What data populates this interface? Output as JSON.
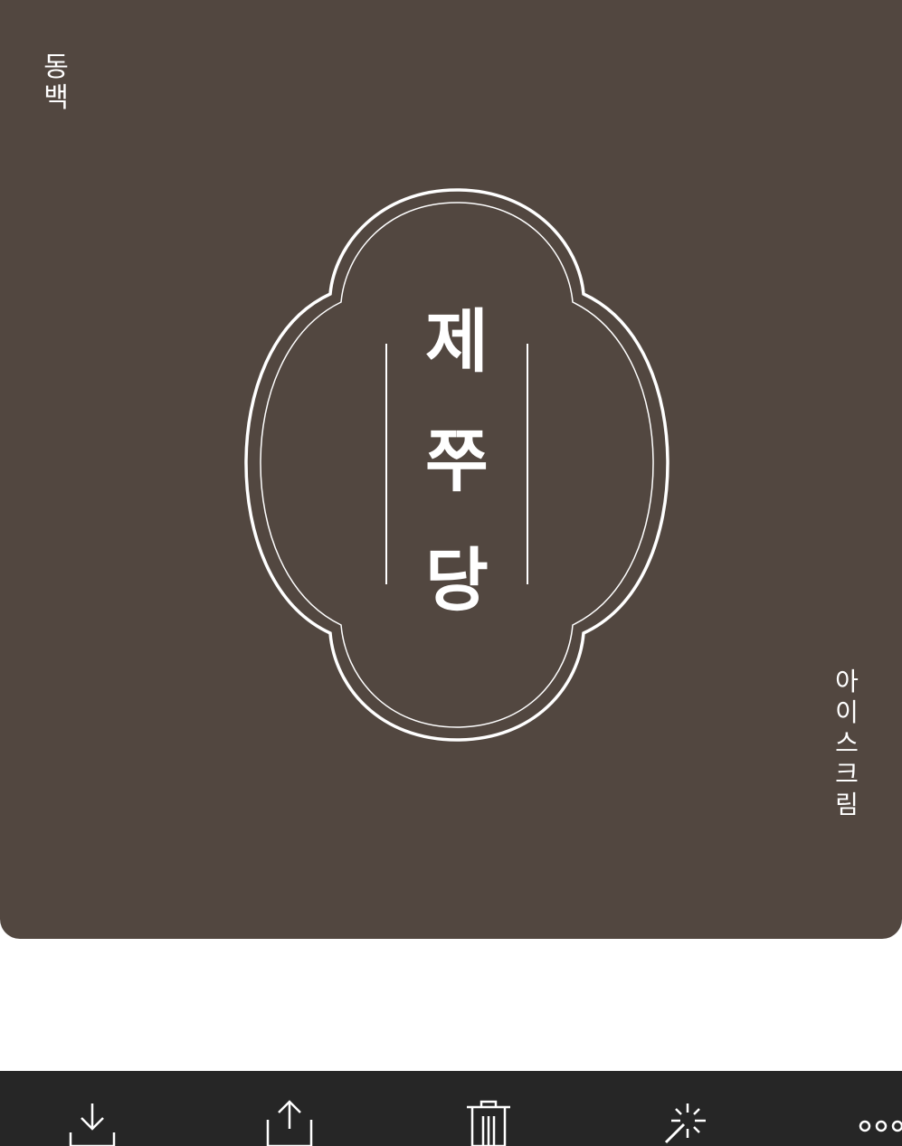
{
  "design": {
    "background_color": "#524740",
    "accent_color": "#ffffff",
    "side_text_top_left": [
      "동",
      "백"
    ],
    "brand_characters": [
      "제",
      "쭈",
      "당"
    ],
    "side_text_bottom_right": [
      "아",
      "이",
      "스",
      "크",
      "림"
    ]
  },
  "toolbar": {
    "background_color": "#262626",
    "icons": [
      "download-icon",
      "share-icon",
      "trash-icon",
      "magic-wand-icon",
      "more-icon"
    ]
  }
}
